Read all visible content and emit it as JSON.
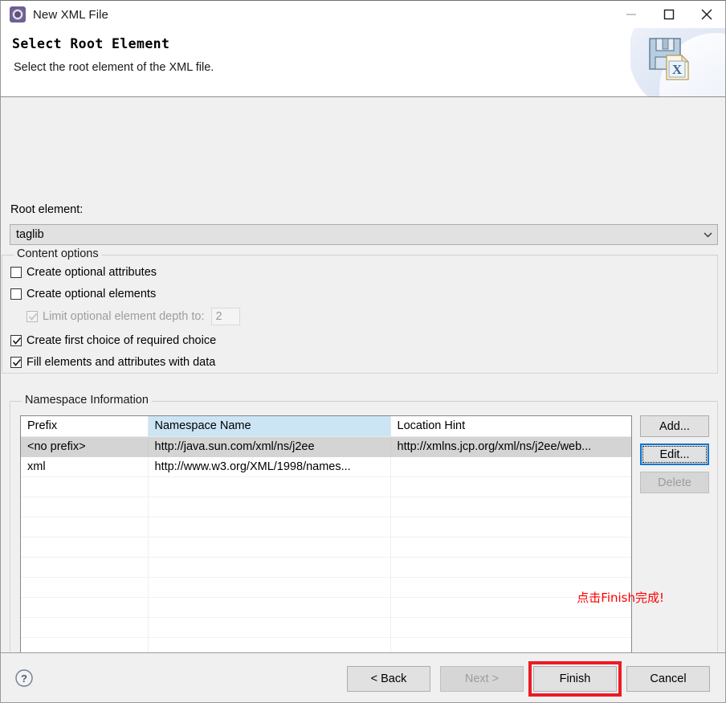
{
  "window": {
    "title": "New XML File",
    "icon": "xml-gear-icon",
    "controls": {
      "minimize": "minimize-icon",
      "maximize": "maximize-icon",
      "close": "close-icon"
    }
  },
  "header": {
    "title": "Select Root Element",
    "description": "Select the root element of the XML file.",
    "banner_icon": "save-xml-file-icon"
  },
  "form": {
    "root_element_label": "Root element:",
    "root_element_value": "taglib",
    "root_element_dropdown_icon": "chevron-down-icon"
  },
  "content_options": {
    "legend": "Content options",
    "items": [
      {
        "label": "Create optional attributes",
        "checked": false,
        "enabled": true
      },
      {
        "label": "Create optional elements",
        "checked": false,
        "enabled": true
      },
      {
        "label": "Limit optional element depth to:",
        "checked": true,
        "enabled": false,
        "value": "2"
      },
      {
        "label": "Create first choice of required choice",
        "checked": true,
        "enabled": true
      },
      {
        "label": "Fill elements and attributes with data",
        "checked": true,
        "enabled": true
      }
    ]
  },
  "namespace_information": {
    "legend": "Namespace Information",
    "columns": [
      "Prefix",
      "Namespace Name",
      "Location Hint"
    ],
    "highlighted_column": "Namespace Name",
    "rows": [
      {
        "prefix": "<no prefix>",
        "namespace_name": "http://java.sun.com/xml/ns/j2ee",
        "location_hint": "http://xmlns.jcp.org/xml/ns/j2ee/web...",
        "selected": true
      },
      {
        "prefix": "xml",
        "namespace_name": "http://www.w3.org/XML/1998/names...",
        "location_hint": "",
        "selected": false
      }
    ],
    "empty_row_count": 11,
    "buttons": [
      {
        "label": "Add...",
        "enabled": true,
        "focused": false
      },
      {
        "label": "Edit...",
        "enabled": true,
        "focused": true
      },
      {
        "label": "Delete",
        "enabled": false,
        "focused": false
      }
    ]
  },
  "annotation": {
    "text": "点击Finish完成!",
    "color": "#ff0000",
    "target": "Finish",
    "highlight_color": "#ec1c24"
  },
  "footer": {
    "help_icon": "help-question-icon",
    "buttons": [
      {
        "label": "< Back",
        "enabled": true
      },
      {
        "label": "Next >",
        "enabled": false
      },
      {
        "label": "Finish",
        "enabled": true,
        "highlighted": true
      },
      {
        "label": "Cancel",
        "enabled": true
      }
    ]
  },
  "colors": {
    "dialog_background": "#f0f0f0",
    "header_background": "#ffffff",
    "focus_blue": "#0078d7",
    "column_highlight": "#cce5f5",
    "row_selection": "#d4d4d4",
    "annotation_red": "#ff0000"
  }
}
